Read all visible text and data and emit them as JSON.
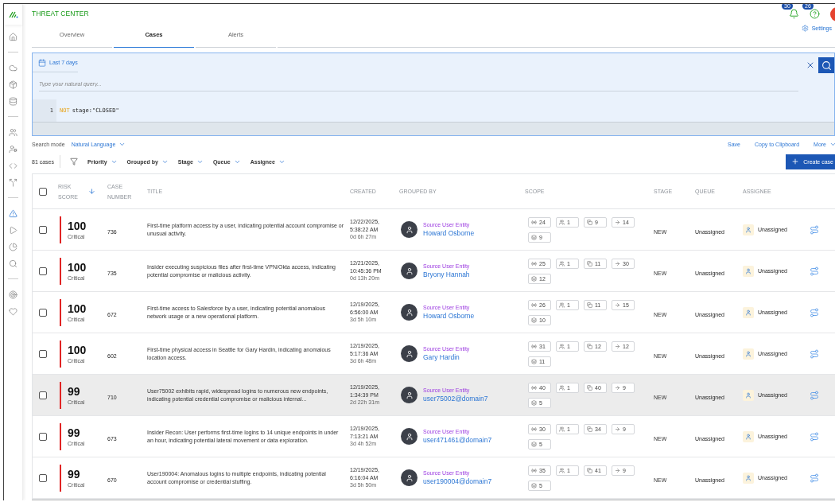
{
  "app": {
    "title": "THREAT CENTER",
    "notifications": "30",
    "help": "26"
  },
  "sidebar": {
    "groups": [
      [
        {
          "selected": false
        }
      ],
      [
        {
          "selected": false
        },
        {
          "selected": false
        },
        {
          "selected": false
        }
      ],
      [
        {
          "selected": false
        },
        {
          "selected": false
        },
        {
          "selected": false
        },
        {
          "selected": false
        }
      ],
      [
        {
          "selected": true
        },
        {
          "selected": false
        },
        {
          "selected": false
        },
        {
          "selected": false
        }
      ],
      [
        {
          "selected": false
        },
        {
          "selected": false
        }
      ]
    ]
  },
  "tabs": [
    {
      "label": "Overview",
      "selected": false
    },
    {
      "label": "Cases",
      "selected": true
    },
    {
      "label": "Alerts",
      "selected": false
    }
  ],
  "settings": "Settings",
  "query": {
    "date_range": "Last 7 days",
    "placeholder": "Type your natural query...",
    "line_number": "1",
    "code": [
      {
        "kind": "keyword",
        "text": "NOT"
      },
      {
        "kind": "plain",
        "text": "stage:\"CLOSED\""
      }
    ]
  },
  "search_mode": {
    "label": "Search mode",
    "value": "Natural Language"
  },
  "actions": [
    {
      "label": "Save",
      "kind": "link"
    },
    {
      "label": "Copy to Clipboard",
      "kind": "link"
    },
    {
      "label": "More",
      "kind": "menu"
    }
  ],
  "toolbar": {
    "count": "81 cases",
    "filters": [
      "Priority",
      "Grouped by",
      "Stage",
      "Queue",
      "Assignee"
    ],
    "create": "Create case"
  },
  "table": {
    "all_checked": false,
    "columns": [
      "RISK SCORE",
      "CASE NUMBER",
      "TITLE",
      "CREATED",
      "GROUPED BY",
      "SCOPE",
      "STAGE",
      "QUEUE",
      "ASSIGNEE"
    ],
    "rows": [
      {
        "checked": false,
        "highlighted": false,
        "score": "100",
        "severity": "Critical",
        "case": "736",
        "title": "First-time platform access by a user, indicating potential account compromise or unusual activity.",
        "date": "12/22/2025,",
        "time": "5:38:22 AM",
        "age": "0d 6h 27m",
        "group_label": "Source User Entity",
        "entity": "Howard Osborne",
        "scope": [
          {
            "kind": "signal",
            "count": "24"
          },
          {
            "kind": "users",
            "count": "1"
          },
          {
            "kind": "copy",
            "count": "9"
          },
          {
            "kind": "arrow",
            "count": "14"
          },
          {
            "kind": "layers",
            "count": "9"
          }
        ],
        "stage": "NEW",
        "queue": "Unassigned",
        "assignee": "Unassigned"
      },
      {
        "checked": false,
        "highlighted": false,
        "score": "100",
        "severity": "Critical",
        "case": "735",
        "title": "Insider executing suspicious files after first-time VPN/Okta access, indicating potential compromise or malicious activity.",
        "date": "12/21/2025,",
        "time": "10:45:36 PM",
        "age": "0d 13h 20m",
        "group_label": "Source User Entity",
        "entity": "Bryony Hannah",
        "scope": [
          {
            "kind": "signal",
            "count": "25"
          },
          {
            "kind": "users",
            "count": "1"
          },
          {
            "kind": "copy",
            "count": "11"
          },
          {
            "kind": "arrow",
            "count": "30"
          },
          {
            "kind": "layers",
            "count": "12"
          }
        ],
        "stage": "NEW",
        "queue": "Unassigned",
        "assignee": "Unassigned"
      },
      {
        "checked": false,
        "highlighted": false,
        "score": "100",
        "severity": "Critical",
        "case": "672",
        "title": "First-time access to Salesforce by a user, indicating potential anomalous network usage or a new operational platform.",
        "date": "12/19/2025,",
        "time": "6:56:00 AM",
        "age": "3d 5h 10m",
        "group_label": "Source User Entity",
        "entity": "Howard Osborne",
        "scope": [
          {
            "kind": "signal",
            "count": "26"
          },
          {
            "kind": "users",
            "count": "1"
          },
          {
            "kind": "copy",
            "count": "11"
          },
          {
            "kind": "arrow",
            "count": "15"
          },
          {
            "kind": "layers",
            "count": "10"
          }
        ],
        "stage": "NEW",
        "queue": "Unassigned",
        "assignee": "Unassigned"
      },
      {
        "checked": false,
        "highlighted": false,
        "score": "100",
        "severity": "Critical",
        "case": "602",
        "title": "First-time physical access in Seattle for Gary Hardin, indicating anomalous location access.",
        "date": "12/19/2025,",
        "time": "5:17:36 AM",
        "age": "3d 6h 48m",
        "group_label": "Source User Entity",
        "entity": "Gary Hardin",
        "scope": [
          {
            "kind": "signal",
            "count": "31"
          },
          {
            "kind": "users",
            "count": "1"
          },
          {
            "kind": "copy",
            "count": "12"
          },
          {
            "kind": "arrow",
            "count": "12"
          },
          {
            "kind": "layers",
            "count": "11"
          }
        ],
        "stage": "NEW",
        "queue": "Unassigned",
        "assignee": "Unassigned"
      },
      {
        "checked": false,
        "highlighted": true,
        "score": "99",
        "severity": "Critical",
        "case": "710",
        "title": "User75002 exhibits rapid, widespread logins to numerous new endpoints, indicating potential credential compromise or malicious internal...",
        "date": "12/19/2025,",
        "time": "1:34:39 PM",
        "age": "2d 22h 31m",
        "group_label": "Source User Entity",
        "entity": "user75002@domain7",
        "scope": [
          {
            "kind": "signal",
            "count": "40"
          },
          {
            "kind": "users",
            "count": "1"
          },
          {
            "kind": "copy",
            "count": "40"
          },
          {
            "kind": "arrow",
            "count": "9"
          },
          {
            "kind": "layers",
            "count": "5"
          }
        ],
        "stage": "NEW",
        "queue": "Unassigned",
        "assignee": "Unassigned"
      },
      {
        "checked": false,
        "highlighted": false,
        "score": "99",
        "severity": "Critical",
        "case": "673",
        "title": "Insider Recon: User performs first-time logins to 14 unique endpoints in under an hour, indicating potential lateral movement or data exploration.",
        "date": "12/19/2025,",
        "time": "7:13:21 AM",
        "age": "3d 4h 52m",
        "group_label": "Source User Entity",
        "entity": "user471461@domain7",
        "scope": [
          {
            "kind": "signal",
            "count": "30"
          },
          {
            "kind": "users",
            "count": "1"
          },
          {
            "kind": "copy",
            "count": "34"
          },
          {
            "kind": "arrow",
            "count": "9"
          },
          {
            "kind": "layers",
            "count": "5"
          }
        ],
        "stage": "NEW",
        "queue": "Unassigned",
        "assignee": "Unassigned"
      },
      {
        "checked": false,
        "highlighted": false,
        "score": "99",
        "severity": "Critical",
        "case": "670",
        "title": "User190004: Anomalous logins to multiple endpoints, indicating potential account compromise or credential stuffing.",
        "date": "12/19/2025,",
        "time": "6:16:04 AM",
        "age": "3d 5h 50m",
        "group_label": "Source User Entity",
        "entity": "user190004@domain7",
        "scope": [
          {
            "kind": "signal",
            "count": "35"
          },
          {
            "kind": "users",
            "count": "1"
          },
          {
            "kind": "copy",
            "count": "41"
          },
          {
            "kind": "arrow",
            "count": "9"
          },
          {
            "kind": "layers",
            "count": "5"
          }
        ],
        "stage": "NEW",
        "queue": "Unassigned",
        "assignee": "Unassigned"
      }
    ]
  }
}
